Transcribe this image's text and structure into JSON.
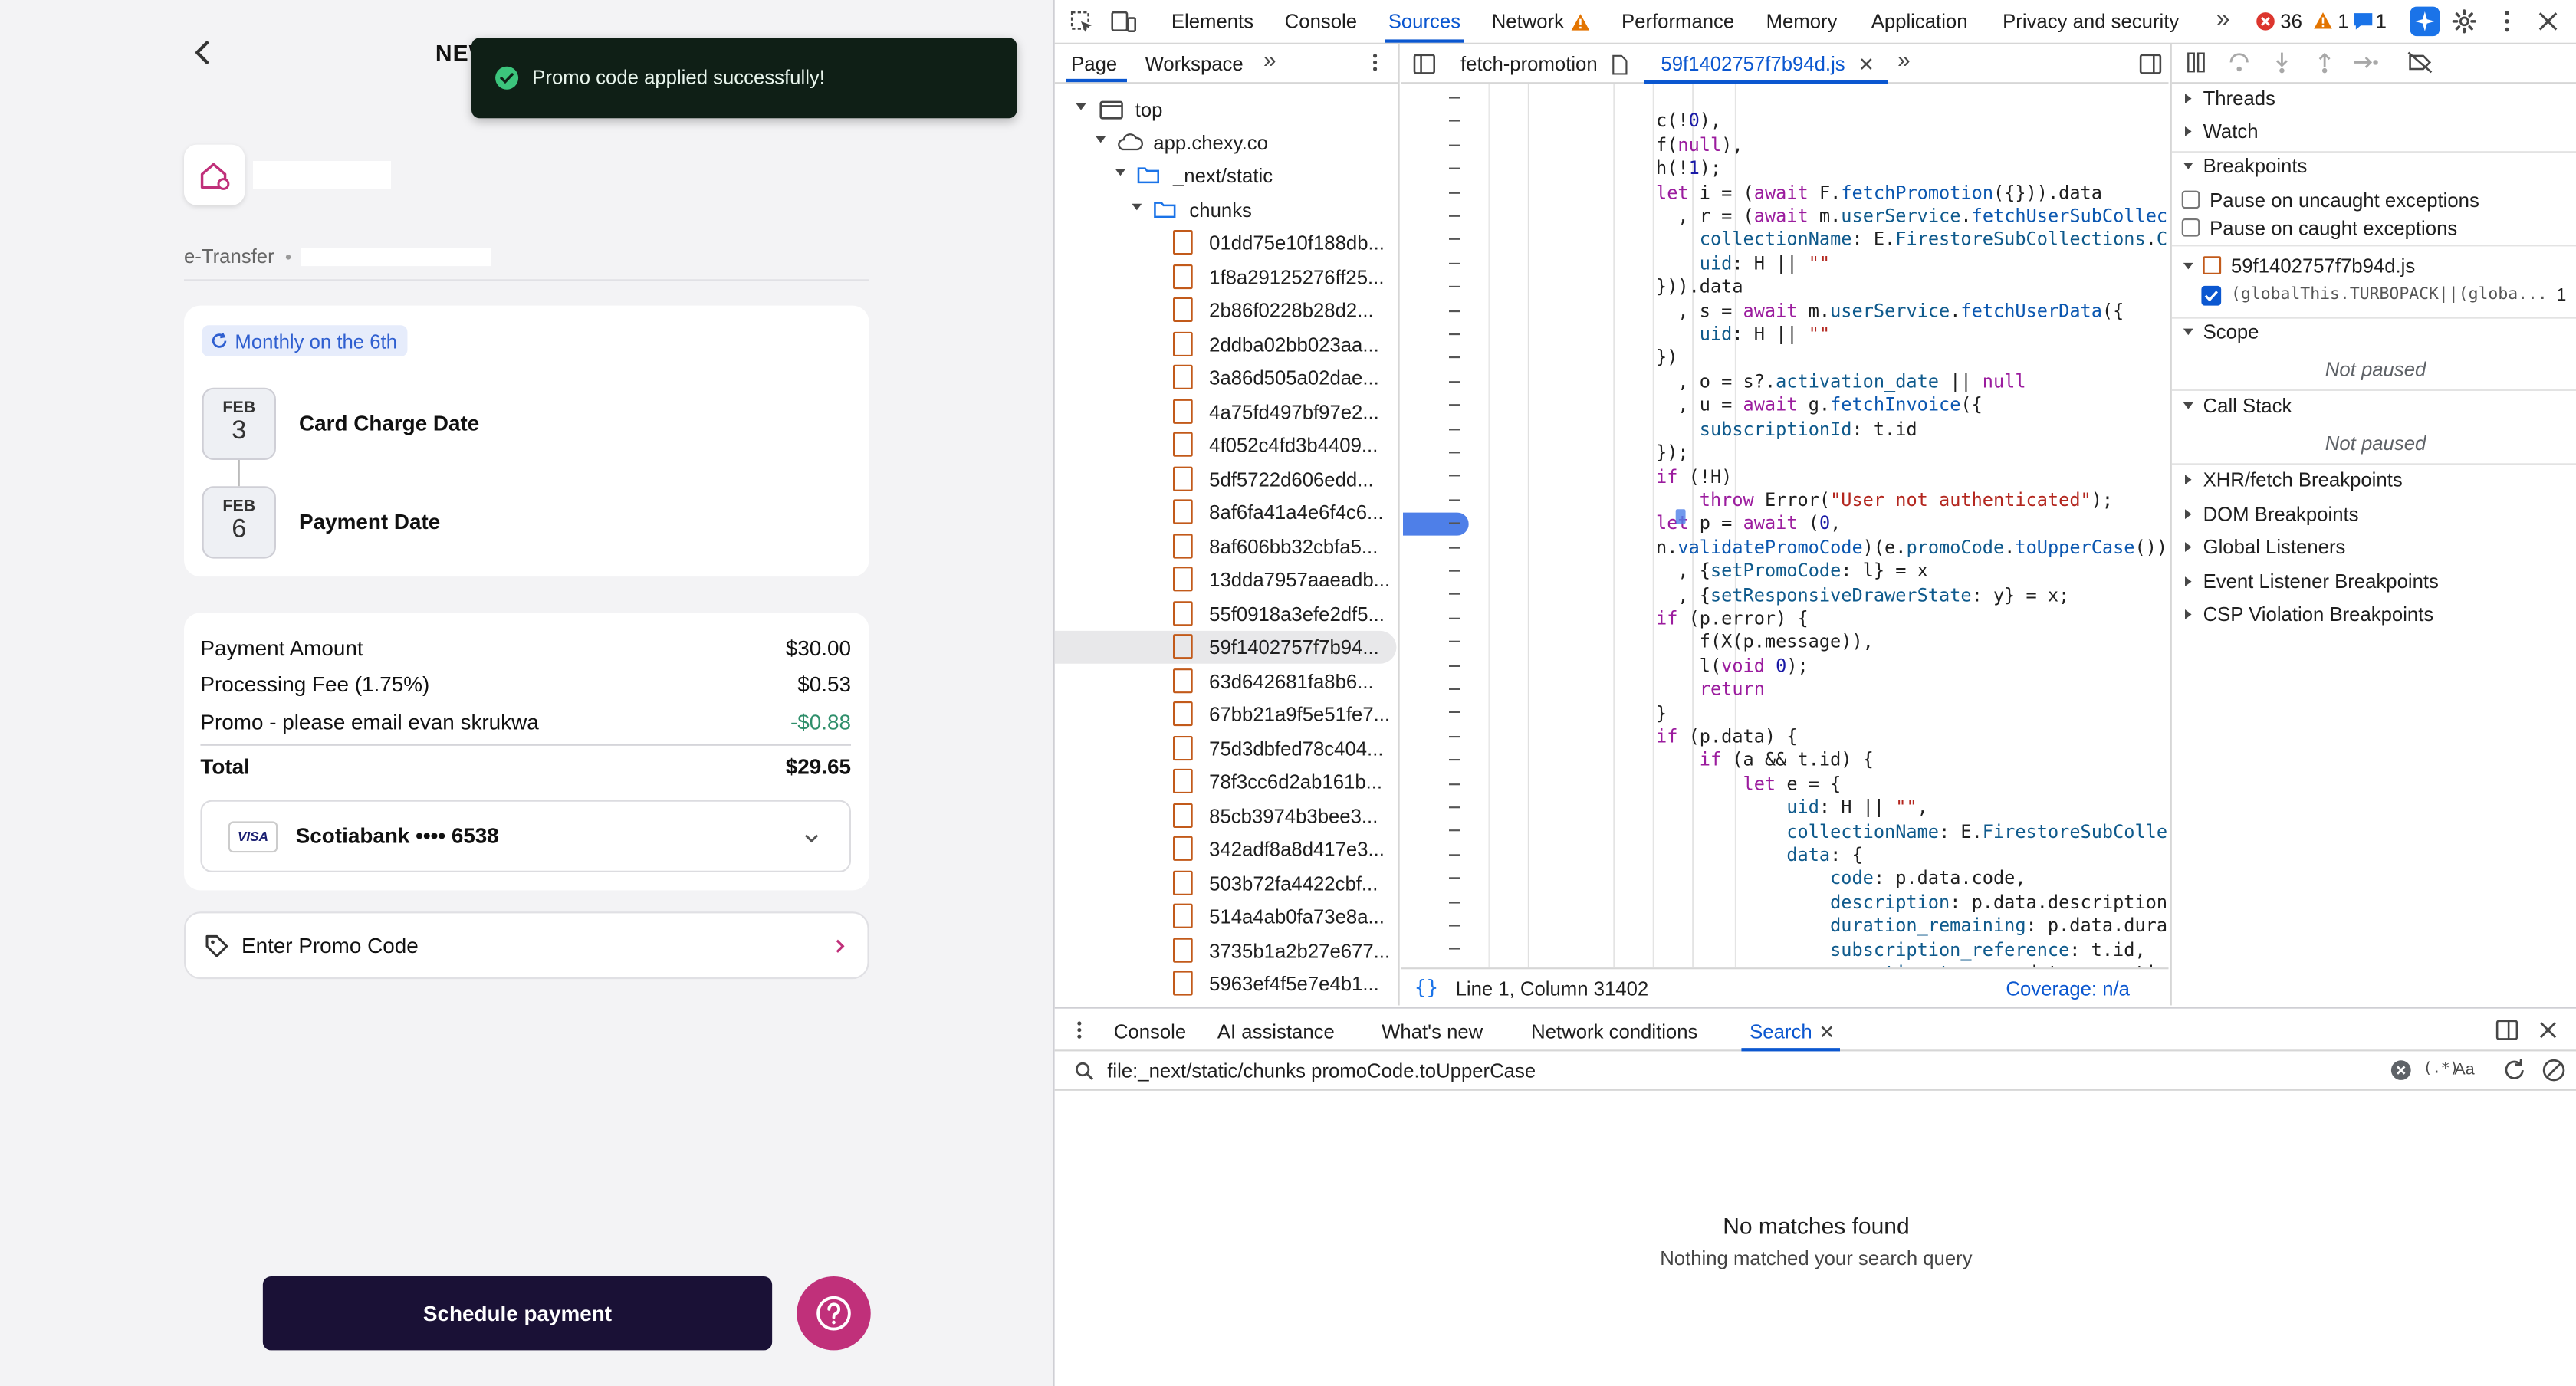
{
  "app": {
    "header_title": "NEW",
    "toast": "Promo code applied successfully!",
    "payee_method": "e-Transfer",
    "schedule_badge": "Monthly on the 6th",
    "dates": [
      {
        "month": "FEB",
        "day": "3",
        "label": "Card Charge Date"
      },
      {
        "month": "FEB",
        "day": "6",
        "label": "Payment Date"
      }
    ],
    "summary": [
      {
        "label": "Payment Amount",
        "value": "$30.00"
      },
      {
        "label": "Processing Fee (1.75%)",
        "value": "$0.53"
      },
      {
        "label": "Promo - please email evan skrukwa",
        "value": "-$0.88"
      }
    ],
    "total_label": "Total",
    "total_value": "$29.65",
    "card_brand": "VISA",
    "card_label": "Scotiabank •••• 6538",
    "promo_label": "Enter Promo Code",
    "schedule_button": "Schedule payment",
    "colors": {
      "accent": "#c0307a",
      "primary": "#1a1136",
      "success": "#2f8f6b",
      "badge": "#2f5fd0"
    }
  },
  "devtools": {
    "toolbar_tabs": [
      "Elements",
      "Console",
      "Sources",
      "Network",
      "Performance",
      "Memory",
      "Application",
      "Privacy and security"
    ],
    "error_count": "36",
    "warning_count": "1",
    "info_count": "1",
    "nav_tabs": [
      "Page",
      "Workspace"
    ],
    "editor_tabs": [
      "fetch-promotion",
      "59f1402757f7b94d.js"
    ],
    "tree": {
      "top": "top",
      "origin": "app.chexy.co",
      "folder1": "_next/static",
      "folder2": "chunks"
    },
    "files": [
      "01dd75e10f188db...",
      "1f8a29125276ff25...",
      "2b86f0228b28d2...",
      "2ddba02bb023aa...",
      "3a86d505a02dae...",
      "4a75fd497bf97e2...",
      "4f052c4fd3b4409...",
      "5df5722d606edd...",
      "8af6fa41a4e6f4c6...",
      "8af606bb32cbfa5...",
      "13dda7957aaeadb...",
      "55f0918a3efe2df5...",
      "59f1402757f7b94...",
      "63d642681fa8b6...",
      "67bb21a9f5e51fe7...",
      "75d3dbfed78c404...",
      "78f3cc6d2ab161b...",
      "85cb3974b3bee3...",
      "342adf8a8d417e3...",
      "503b72fa4422cbf...",
      "514a4ab0fa73e8a...",
      "3735b1a2b27e677...",
      "5963ef4f5e7e4b1..."
    ],
    "status_position": "Line 1, Column 31402",
    "coverage": "Coverage: n/a",
    "right_panel": {
      "threads": "Threads",
      "watch": "Watch",
      "breakpoints": "Breakpoints",
      "pause_uncaught": "Pause on uncaught exceptions",
      "pause_caught": "Pause on caught exceptions",
      "bp_file": "59f1402757f7b94d.js",
      "bp_line": "(globalThis.TURBOPACK||(globa...",
      "bp_num": "1",
      "scope": "Scope",
      "not_paused_1": "Not paused",
      "call_stack": "Call Stack",
      "not_paused_2": "Not paused",
      "xhr": "XHR/fetch Breakpoints",
      "dom": "DOM Breakpoints",
      "global": "Global Listeners",
      "event": "Event Listener Breakpoints",
      "csp": "CSP Violation Breakpoints"
    },
    "drawer_tabs": [
      "Console",
      "AI assistance",
      "What's new",
      "Network conditions",
      "Search"
    ],
    "search_query": "file:_next/static/chunks promoCode.toUpperCase",
    "no_matches_title": "No matches found",
    "no_matches_sub": "Nothing matched your search query"
  }
}
